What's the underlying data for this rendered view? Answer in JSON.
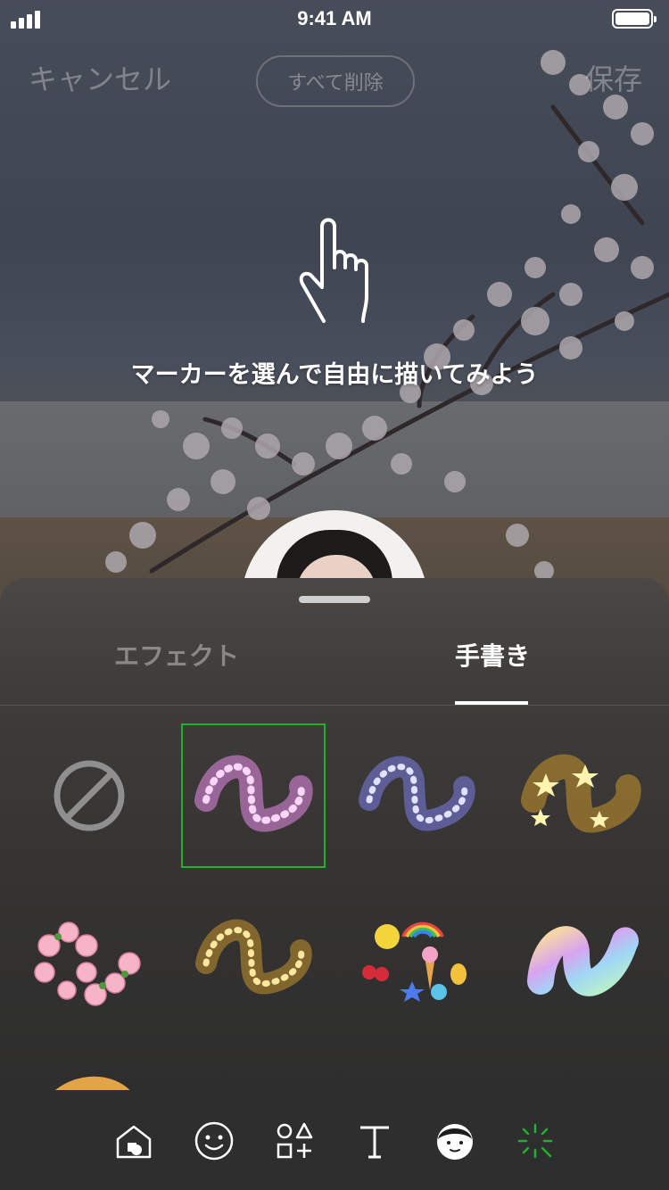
{
  "status_bar": {
    "time": "9:41 AM"
  },
  "header": {
    "cancel_label": "キャンセル",
    "delete_all_label": "すべて削除",
    "save_label": "保存"
  },
  "hint": {
    "text": "マーカーを選んで自由に描いてみよう"
  },
  "sheet": {
    "tabs": [
      {
        "label": "エフェクト",
        "selected": false
      },
      {
        "label": "手書き",
        "selected": true
      }
    ],
    "markers": [
      {
        "name": "none",
        "icon": "prohibited-icon"
      },
      {
        "name": "pink-sparkle",
        "color": "#e78ce8",
        "selected": true
      },
      {
        "name": "blue-sparkle",
        "color": "#8a8cf0"
      },
      {
        "name": "gold-stars",
        "color": "#f2c23c"
      },
      {
        "name": "cherry-blossom",
        "color": "#f6b4c8"
      },
      {
        "name": "gold-sparkle",
        "color": "#e9b63a"
      },
      {
        "name": "stickers",
        "color": "#f5d33a"
      },
      {
        "name": "rainbow-gradient",
        "color": "#c7a4f0"
      },
      {
        "name": "partial-marker",
        "color": "#e3a447"
      }
    ]
  },
  "toolbar": {
    "items": [
      {
        "icon": "background-icon"
      },
      {
        "icon": "emoji-icon"
      },
      {
        "icon": "shapes-icon"
      },
      {
        "icon": "text-icon"
      },
      {
        "icon": "avatar-icon"
      },
      {
        "icon": "sparkle-brush-icon",
        "active": true
      }
    ],
    "accent_color": "#1fb12b"
  }
}
